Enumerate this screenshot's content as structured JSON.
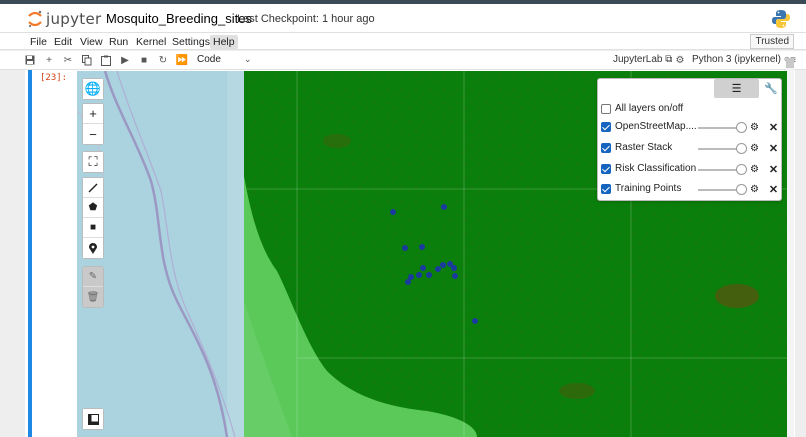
{
  "header": {
    "logo_text": "jupyter",
    "notebook_title": "Mosquito_Breeding_sites",
    "checkpoint": "Last Checkpoint: 1 hour ago"
  },
  "menu": {
    "items": [
      "File",
      "Edit",
      "View",
      "Run",
      "Kernel",
      "Settings",
      "Help"
    ],
    "active": "Help",
    "trusted_label": "Trusted"
  },
  "toolbar": {
    "buttons": [
      "save-icon",
      "add-cell-icon",
      "cut-icon",
      "copy-icon",
      "paste-icon",
      "run-icon",
      "stop-icon",
      "restart-icon",
      "fast-forward-icon"
    ],
    "cell_type": "Code",
    "jupyterlab_label": "JupyterLab",
    "kernel_label": "Python 3 (ipykernel)"
  },
  "cell": {
    "prompt": "[23]:"
  },
  "map_controls": {
    "zoom_in": "+",
    "zoom_out": "−"
  },
  "layers_control": {
    "all_layers_label": "All layers on/off",
    "all_layers_checked": false,
    "layers": [
      {
        "label": "OpenStreetMap....",
        "checked": true,
        "opacity": 1.0
      },
      {
        "label": "Raster Stack",
        "checked": true,
        "opacity": 1.0
      },
      {
        "label": "Risk Classification",
        "checked": true,
        "opacity": 1.0
      },
      {
        "label": "Training Points",
        "checked": true,
        "opacity": 1.0
      }
    ]
  },
  "colors": {
    "accent": "#1e88e5",
    "dark_green": "#0b7f0b",
    "light_green": "#5ac95a",
    "water": "#aad3df",
    "points": "#1a3a9e"
  }
}
